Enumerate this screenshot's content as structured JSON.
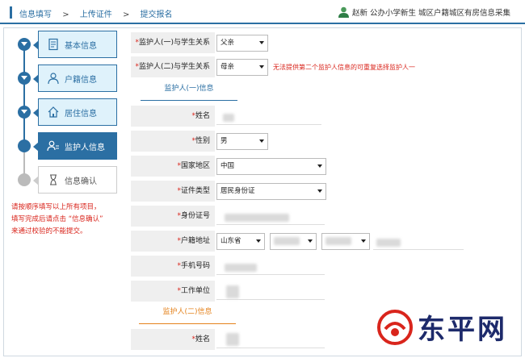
{
  "breadcrumb": {
    "items": [
      "信息填写",
      "上传证件",
      "提交报名"
    ],
    "sep": ">"
  },
  "user": {
    "text": "赵新 公办小学新生 城区户籍城区有房信息采集"
  },
  "steps": [
    {
      "label": "基本信息",
      "icon": "document-icon"
    },
    {
      "label": "户籍信息",
      "icon": "person-icon"
    },
    {
      "label": "居住信息",
      "icon": "home-icon"
    },
    {
      "label": "监护人信息",
      "icon": "guardian-icon"
    },
    {
      "label": "信息确认",
      "icon": "hourglass-icon"
    }
  ],
  "note": {
    "line1": "请按顺序填写以上所有项目，",
    "line2": "填写完成后请点击 “信息确认”",
    "line3": "来通过校验的不能提交。"
  },
  "form": {
    "rel1": {
      "label": "监护人(一)与学生关系",
      "value": "父亲"
    },
    "rel2": {
      "label": "监护人(二)与学生关系",
      "value": "母亲",
      "error": "无法提供第二个监护人信息的可重复选择监护人一"
    },
    "section1": "监护人(一)信息",
    "name": "姓名",
    "gender": {
      "label": "性别",
      "value": "男"
    },
    "country": {
      "label": "国家地区",
      "value": "中国"
    },
    "idtype": {
      "label": "证件类型",
      "value": "居民身份证"
    },
    "idnum": "身份证号",
    "address": {
      "label": "户籍地址",
      "province": "山东省"
    },
    "phone": "手机号码",
    "work": "工作单位",
    "section2": "监护人(二)信息",
    "name2": "姓名"
  },
  "watermark": {
    "text": "东平网"
  },
  "colors": {
    "accent": "#2b6fa3",
    "error": "#d9251c",
    "section2": "#e4821c"
  }
}
